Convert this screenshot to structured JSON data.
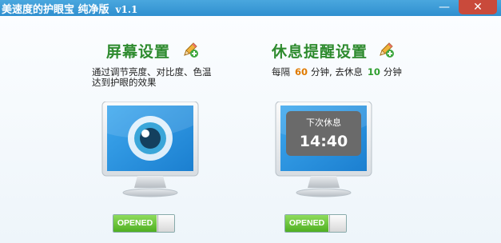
{
  "window": {
    "title": "美速度的护眼宝 纯净版",
    "version": "v1.1",
    "minimize_glyph": "—",
    "close_glyph": "✕"
  },
  "screen_settings": {
    "title": "屏幕设置",
    "edit_icon": "pencil-plus-icon",
    "desc_line1": "通过调节亮度、对比度、色温",
    "desc_line2": "达到护眼的效果",
    "monitor_icon": "eye-icon",
    "toggle_label": "OPENED",
    "toggle_on": true
  },
  "rest_reminder": {
    "title": "休息提醒设置",
    "edit_icon": "pencil-plus-icon",
    "desc_prefix": "每隔",
    "interval": "60",
    "desc_middle": "分钟, 去休息",
    "duration": "10",
    "desc_suffix": "分钟",
    "next_rest_label": "下次休息",
    "next_rest_time": "14:40",
    "toggle_label": "OPENED",
    "toggle_on": true
  },
  "colors": {
    "titlebar": "#3a9ad6",
    "section_title": "#2e8b2e",
    "interval_value": "#e07a00",
    "duration_value": "#2e9e2e",
    "toggle_on": "#5cbf2a"
  }
}
